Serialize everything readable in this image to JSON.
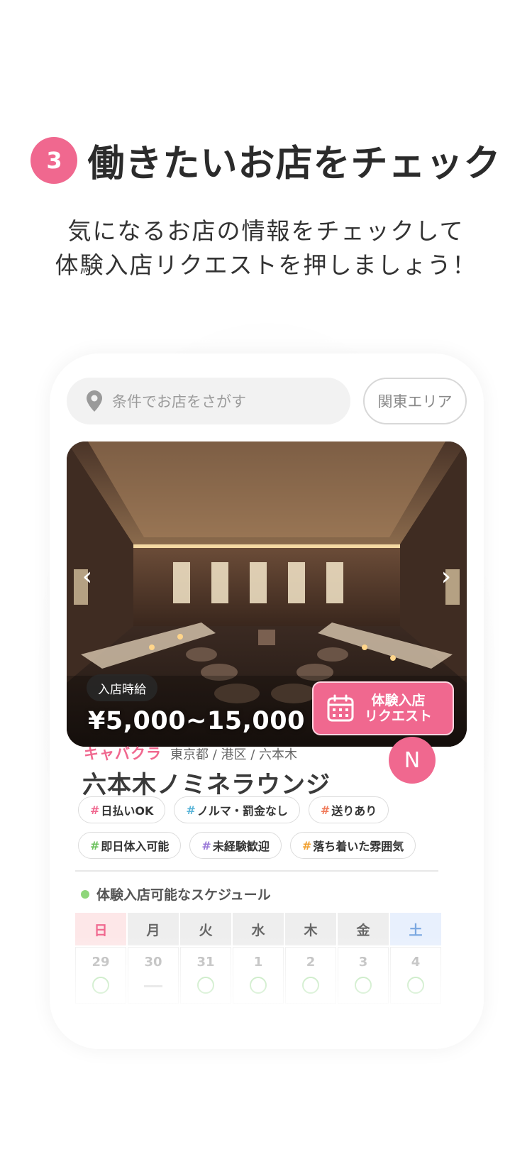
{
  "heading": {
    "step": "3",
    "title": "働きたいお店をチェック"
  },
  "subtitle": {
    "line1": "気になるお店の情報をチェックして",
    "line2": "体験入店リクエストを押しましょう！"
  },
  "search": {
    "placeholder": "条件でお店をさがす",
    "area": "関東エリア"
  },
  "photo": {
    "time_label": "入店時給",
    "price": "¥5,000~15,000",
    "request_button": {
      "line1": "体験入店",
      "line2": "リクエスト"
    }
  },
  "shop": {
    "category": "キャバクラ",
    "location": "東京都 / 港区 / 六本木",
    "name": "六本木ノミネラウンジ",
    "avatar": "N"
  },
  "tags": [
    [
      "日払いOK",
      "ノルマ・罰金なし",
      "送りあり"
    ],
    [
      "即日体入可能",
      "未経験歓迎",
      "落ち着いた雰囲気"
    ]
  ],
  "tag_hash_colors": [
    "#f0688f",
    "#5ab4d8",
    "#f07a5a",
    "#6cc25e",
    "#9b7ad8",
    "#f0a030"
  ],
  "schedule": {
    "title": "体験入店可能なスケジュール",
    "days": [
      "日",
      "月",
      "火",
      "水",
      "木",
      "金",
      "土"
    ],
    "dates": [
      "29",
      "30",
      "31",
      "1",
      "2",
      "3",
      "4"
    ],
    "available": [
      true,
      false,
      true,
      true,
      true,
      true,
      true
    ]
  },
  "colors": {
    "accent": "#f0688f",
    "available": "#a7dea0"
  }
}
